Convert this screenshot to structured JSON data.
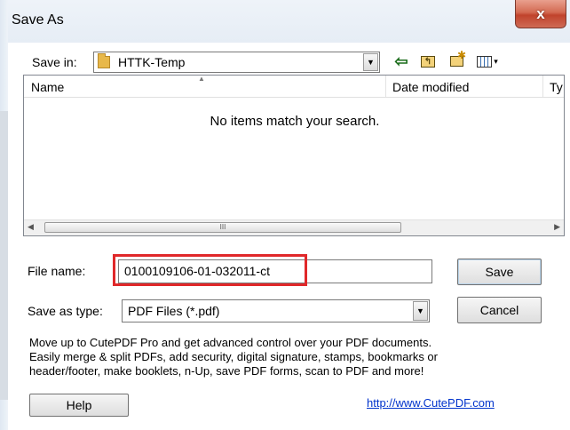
{
  "window": {
    "title": "Save As",
    "close_glyph": "x"
  },
  "toolbar": {
    "save_in_label": "Save in:",
    "save_in_value": "HTTK-Temp",
    "views_glyph": "▾"
  },
  "file_list": {
    "columns": [
      "Name",
      "Date modified",
      "Ty"
    ],
    "empty_message": "No items match your search.",
    "scroll_thumb_grip": "III"
  },
  "form": {
    "file_name_label": "File name:",
    "file_name_value": "0100109106-01-032011-ct",
    "save_as_type_label": "Save as type:",
    "save_as_type_value": "PDF Files (*.pdf)"
  },
  "buttons": {
    "save": "Save",
    "cancel": "Cancel",
    "help": "Help"
  },
  "promo": {
    "lines": [
      "Move up to CutePDF Pro and get advanced control over your PDF documents.",
      "Easily merge & split PDFs, add security, digital signature, stamps, bookmarks or",
      "header/footer, make booklets, n-Up, save PDF forms, scan to PDF and more!"
    ],
    "link": "http://www.CutePDF.com"
  },
  "colors": {
    "highlight": "#e0282a",
    "close_button": "#c75a44",
    "link": "#0033cc"
  }
}
